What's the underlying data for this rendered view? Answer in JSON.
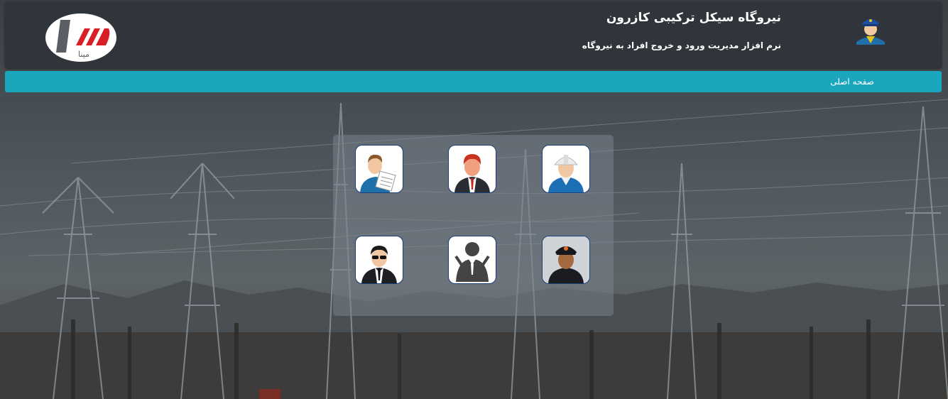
{
  "header": {
    "title": "نیروگاه سیکل ترکیبی کازرون",
    "subtitle": "نرم افزار مدیریت ورود و خروج افراد به نیروگاه",
    "logo_text": "مپنا"
  },
  "nav": {
    "home_label": "صفحه اصلی"
  },
  "tiles": [
    {
      "icon": "engineer-hardhat-icon"
    },
    {
      "icon": "manager-red-hair-icon"
    },
    {
      "icon": "clerk-document-icon"
    },
    {
      "icon": "police-officer-icon"
    },
    {
      "icon": "business-person-icon"
    },
    {
      "icon": "security-agent-sunglasses-icon"
    }
  ],
  "colors": {
    "header_bg": "#30353b",
    "navbar_bg": "#1aa6bd",
    "tile_border": "#1c3f7a",
    "brand_red": "#d91f26"
  }
}
